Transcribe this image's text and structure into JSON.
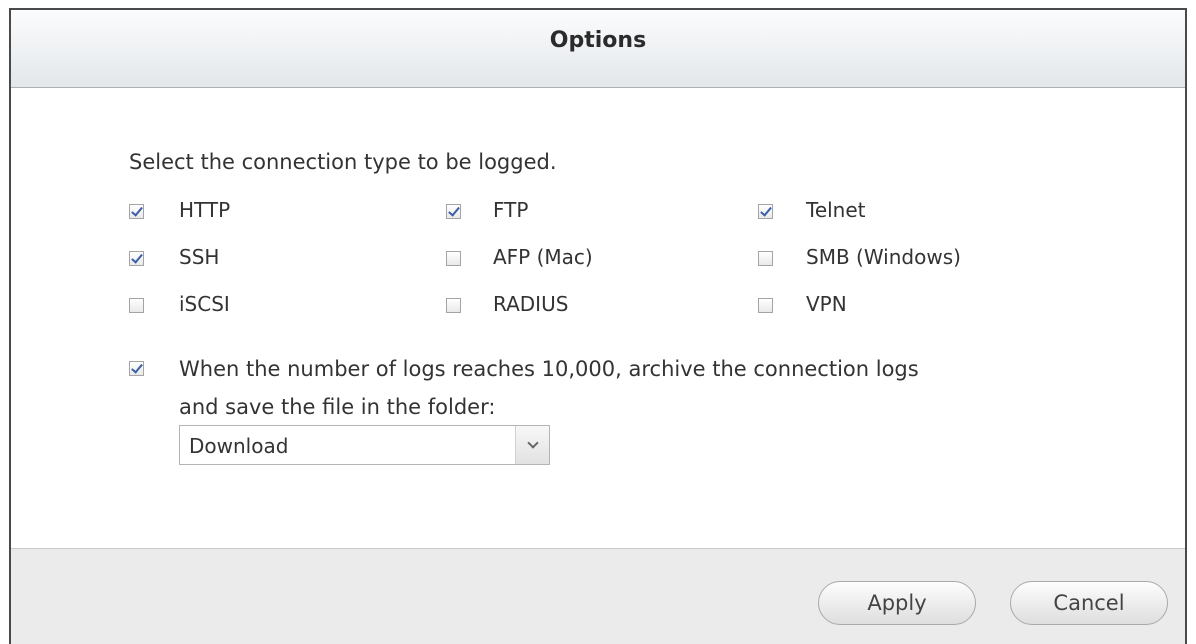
{
  "dialog": {
    "title": "Options"
  },
  "connection_logging": {
    "instruction": "Select the connection type to be logged.",
    "options": [
      {
        "label": "HTTP",
        "checked": true
      },
      {
        "label": "FTP",
        "checked": true
      },
      {
        "label": "Telnet",
        "checked": true
      },
      {
        "label": "SSH",
        "checked": true
      },
      {
        "label": "AFP (Mac)",
        "checked": false
      },
      {
        "label": "SMB (Windows)",
        "checked": false
      },
      {
        "label": "iSCSI",
        "checked": false
      },
      {
        "label": "RADIUS",
        "checked": false
      },
      {
        "label": "VPN",
        "checked": false
      }
    ]
  },
  "archive": {
    "checked": true,
    "label_line1": "When the number of logs reaches 10,000, archive the connection logs",
    "label_line2": "and save the file in the folder:",
    "folder_selected": "Download"
  },
  "footer": {
    "apply_label": "Apply",
    "cancel_label": "Cancel"
  },
  "icons": {
    "checkbox_check": "checkmark-icon",
    "dropdown": "chevron-down-icon"
  },
  "colors": {
    "check_mark": "#3a5ea8",
    "footer_bg": "#ebebeb",
    "titlebar_bottom": "#e3e7ea"
  }
}
